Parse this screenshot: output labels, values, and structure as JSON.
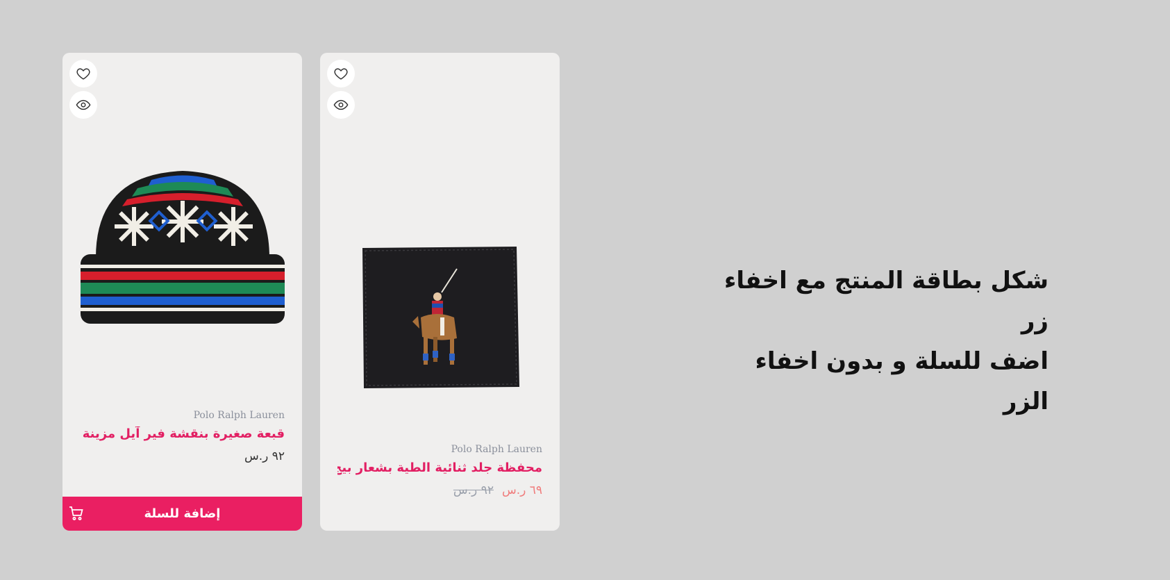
{
  "headline": {
    "line1": "شكل بطاقة المنتج مع اخفاء زر",
    "line2": "اضف للسلة و بدون اخفاء الزر"
  },
  "colors": {
    "accent": "#ea1f62",
    "sale_price": "#f07c7c",
    "card_bg": "#f0efee",
    "page_bg": "#d0d0d0"
  },
  "cards": [
    {
      "brand": "Polo Ralph Lauren",
      "name": "قبعة صغيرة بنقشة فير آيل مزينة بد...",
      "price": "٩٢ ر.س",
      "add_to_cart_label": "إضافة للسلة",
      "icons": [
        "heart-icon",
        "eye-icon",
        "cart-icon"
      ]
    },
    {
      "brand": "Polo Ralph Lauren",
      "name": "محفظة جلد ثنائية الطية بشعار بيج...",
      "sale_price": "٦٩ ر.س",
      "old_price": "٩٢ ر.س",
      "icons": [
        "heart-icon",
        "eye-icon"
      ]
    }
  ]
}
